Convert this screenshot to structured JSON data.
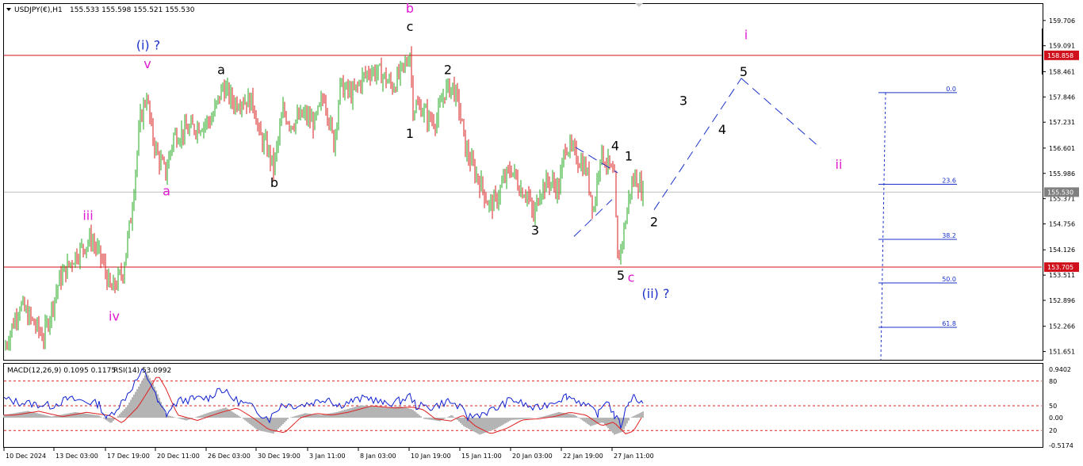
{
  "header": {
    "symbol": "USDJPY(€),H1",
    "quote": "155.533 155.598 155.521 155.530"
  },
  "indicator_header": {
    "macd": "MACD(12,26,9) 0.1095 0.1175",
    "rsi": "RSI(14) 53.0992"
  },
  "colors": {
    "bull": "#22a822",
    "bear": "#d81e1e",
    "hline": "#d0101a",
    "magenta": "#e01ad0",
    "blue": "#1a32c8",
    "black": "#000000",
    "macd_hist": "#b4b4b4",
    "macd_signal": "#e02020",
    "rsi_line": "#1020d0"
  },
  "chart_data": [
    {
      "type": "candlestick",
      "symbol": "USDJPY(€)",
      "timeframe": "H1",
      "ohlc_last": {
        "open": 155.533,
        "high": 155.598,
        "low": 155.521,
        "close": 155.53
      },
      "ylim": [
        151.45,
        160.05
      ],
      "y_tick_labels": [
        "159.706",
        "159.091",
        "158.461",
        "157.846",
        "157.231",
        "156.601",
        "155.986",
        "155.371",
        "154.756",
        "154.126",
        "153.511",
        "152.896",
        "152.266",
        "151.651"
      ],
      "x_tick_labels": [
        "10 Dec 2024",
        "13 Dec 03:00",
        "17 Dec 19:00",
        "20 Dec 11:00",
        "26 Dec 03:00",
        "30 Dec 19:00",
        "3 Jan 11:00",
        "8 Jan 03:00",
        "10 Jan 19:00",
        "15 Jan 11:00",
        "20 Jan 03:00",
        "22 Jan 19:00",
        "27 Jan 11:00"
      ],
      "price_path": [
        [
          0,
          151.7
        ],
        [
          20,
          152.8
        ],
        [
          50,
          152.0
        ],
        [
          70,
          153.4
        ],
        [
          90,
          154.0
        ],
        [
          110,
          154.4
        ],
        [
          125,
          153.8
        ],
        [
          135,
          153.1
        ],
        [
          150,
          153.6
        ],
        [
          160,
          154.9
        ],
        [
          168,
          156.5
        ],
        [
          172,
          157.3
        ],
        [
          180,
          157.9
        ],
        [
          186,
          157.0
        ],
        [
          194,
          156.4
        ],
        [
          204,
          156.0
        ],
        [
          214,
          156.9
        ],
        [
          226,
          157.0
        ],
        [
          240,
          157.1
        ],
        [
          262,
          157.3
        ],
        [
          276,
          158.1
        ],
        [
          290,
          157.7
        ],
        [
          300,
          157.8
        ],
        [
          315,
          157.7
        ],
        [
          322,
          156.9
        ],
        [
          332,
          156.6
        ],
        [
          340,
          156.1
        ],
        [
          352,
          157.5
        ],
        [
          362,
          157.2
        ],
        [
          378,
          157.4
        ],
        [
          392,
          157.2
        ],
        [
          404,
          157.9
        ],
        [
          416,
          156.7
        ],
        [
          424,
          158.1
        ],
        [
          440,
          157.9
        ],
        [
          452,
          158.3
        ],
        [
          462,
          158.5
        ],
        [
          476,
          158.4
        ],
        [
          490,
          158.1
        ],
        [
          500,
          158.4
        ],
        [
          508,
          158.7
        ],
        [
          512,
          158.95
        ],
        [
          516,
          157.6
        ],
        [
          526,
          157.6
        ],
        [
          536,
          157.3
        ],
        [
          546,
          157.3
        ],
        [
          556,
          158.0
        ],
        [
          566,
          158.1
        ],
        [
          574,
          157.6
        ],
        [
          582,
          156.6
        ],
        [
          592,
          156.1
        ],
        [
          602,
          155.7
        ],
        [
          612,
          155.2
        ],
        [
          620,
          155.3
        ],
        [
          630,
          155.8
        ],
        [
          640,
          156.1
        ],
        [
          652,
          155.6
        ],
        [
          660,
          155.5
        ],
        [
          668,
          154.9
        ],
        [
          676,
          155.6
        ],
        [
          688,
          155.8
        ],
        [
          700,
          155.6
        ],
        [
          708,
          156.7
        ],
        [
          722,
          156.4
        ],
        [
          734,
          156.1
        ],
        [
          744,
          155.1
        ],
        [
          752,
          156.5
        ],
        [
          762,
          156.2
        ],
        [
          770,
          155.8
        ],
        [
          774,
          153.8
        ],
        [
          782,
          154.6
        ],
        [
          790,
          155.6
        ],
        [
          796,
          155.9
        ],
        [
          806,
          155.53
        ]
      ],
      "horizontal_levels": [
        158.858,
        153.705
      ],
      "current_price": 155.53,
      "fibonacci": {
        "levels": [
          "0.0",
          "23.6",
          "38.2",
          "50.0",
          "61.8"
        ],
        "prices": [
          157.95,
          155.72,
          154.38,
          153.32,
          152.24
        ]
      },
      "projection": {
        "points": [
          [
            820,
            155.1
          ],
          [
            930,
            158.3
          ],
          [
            1030,
            156.6
          ]
        ]
      },
      "wave_labels": [
        {
          "text": "(i) ?",
          "price": 159.0,
          "bar": 182,
          "color": "blue"
        },
        {
          "text": "v",
          "price": 158.55,
          "bar": 181,
          "color": "magenta"
        },
        {
          "text": "a",
          "price": 158.4,
          "bar": 274,
          "color": "black"
        },
        {
          "text": "a",
          "price": 155.45,
          "bar": 205,
          "color": "magenta"
        },
        {
          "text": "b",
          "price": 155.65,
          "bar": 341,
          "color": "black"
        },
        {
          "text": "b",
          "price": 159.9,
          "bar": 512,
          "color": "magenta"
        },
        {
          "text": "c",
          "price": 159.45,
          "bar": 512,
          "color": "black"
        },
        {
          "text": "2",
          "price": 158.4,
          "bar": 560,
          "color": "black"
        },
        {
          "text": "1",
          "price": 156.85,
          "bar": 512,
          "color": "black"
        },
        {
          "text": "3",
          "price": 154.5,
          "bar": 670,
          "color": "black"
        },
        {
          "text": "4",
          "price": 156.55,
          "bar": 771,
          "color": "black"
        },
        {
          "text": "1",
          "price": 156.3,
          "bar": 788,
          "color": "black"
        },
        {
          "text": "2",
          "price": 154.7,
          "bar": 820,
          "color": "black"
        },
        {
          "text": "5",
          "price": 153.4,
          "bar": 778,
          "color": "black"
        },
        {
          "text": "c",
          "price": 153.35,
          "bar": 791,
          "color": "magenta"
        },
        {
          "text": "(ii) ?",
          "price": 152.95,
          "bar": 822,
          "color": "blue"
        },
        {
          "text": "iii",
          "price": 154.85,
          "bar": 106,
          "color": "magenta"
        },
        {
          "text": "iv",
          "price": 152.4,
          "bar": 139,
          "color": "magenta"
        },
        {
          "text": "i",
          "price": 159.25,
          "bar": 936,
          "color": "magenta"
        },
        {
          "text": "5",
          "price": 158.35,
          "bar": 933,
          "color": "black"
        },
        {
          "text": "3",
          "price": 157.65,
          "bar": 857,
          "color": "black"
        },
        {
          "text": "4",
          "price": 156.95,
          "bar": 906,
          "color": "black"
        },
        {
          "text": "ii",
          "price": 156.1,
          "bar": 1053,
          "color": "magenta"
        }
      ]
    },
    {
      "type": "line",
      "name": "MACD(12,26,9) / RSI(14)",
      "macd_main": 0.1095,
      "macd_signal": 0.1175,
      "rsi": 53.0992,
      "y_tick_labels": [
        "0.9402",
        "80",
        "50",
        "0.00",
        "20",
        "-0.5174"
      ],
      "rsi_levels": [
        80,
        50,
        20
      ],
      "rsi_path": [
        [
          0,
          58
        ],
        [
          20,
          54
        ],
        [
          40,
          52
        ],
        [
          60,
          50
        ],
        [
          80,
          58
        ],
        [
          100,
          56
        ],
        [
          120,
          52
        ],
        [
          130,
          34
        ],
        [
          150,
          56
        ],
        [
          165,
          78
        ],
        [
          175,
          92
        ],
        [
          185,
          78
        ],
        [
          195,
          52
        ],
        [
          205,
          40
        ],
        [
          220,
          56
        ],
        [
          240,
          58
        ],
        [
          260,
          60
        ],
        [
          272,
          72
        ],
        [
          290,
          58
        ],
        [
          310,
          50
        ],
        [
          325,
          40
        ],
        [
          335,
          34
        ],
        [
          350,
          52
        ],
        [
          370,
          50
        ],
        [
          390,
          54
        ],
        [
          410,
          60
        ],
        [
          420,
          50
        ],
        [
          440,
          56
        ],
        [
          460,
          60
        ],
        [
          480,
          52
        ],
        [
          500,
          56
        ],
        [
          512,
          62
        ],
        [
          520,
          50
        ],
        [
          540,
          48
        ],
        [
          560,
          56
        ],
        [
          575,
          48
        ],
        [
          585,
          36
        ],
        [
          600,
          40
        ],
        [
          620,
          46
        ],
        [
          640,
          58
        ],
        [
          655,
          52
        ],
        [
          670,
          46
        ],
        [
          685,
          52
        ],
        [
          700,
          58
        ],
        [
          710,
          62
        ],
        [
          725,
          56
        ],
        [
          740,
          46
        ],
        [
          750,
          40
        ],
        [
          760,
          58
        ],
        [
          770,
          38
        ],
        [
          778,
          26
        ],
        [
          788,
          56
        ],
        [
          795,
          62
        ],
        [
          806,
          53
        ]
      ],
      "macd_path": [
        [
          0,
          0.05
        ],
        [
          30,
          0.12
        ],
        [
          60,
          0.02
        ],
        [
          90,
          0.1
        ],
        [
          120,
          0.04
        ],
        [
          135,
          -0.1
        ],
        [
          155,
          0.2
        ],
        [
          170,
          0.55
        ],
        [
          180,
          0.8
        ],
        [
          190,
          0.55
        ],
        [
          205,
          0.05
        ],
        [
          230,
          -0.05
        ],
        [
          260,
          0.1
        ],
        [
          280,
          0.18
        ],
        [
          300,
          0.0
        ],
        [
          320,
          -0.22
        ],
        [
          340,
          -0.28
        ],
        [
          360,
          0.0
        ],
        [
          380,
          0.08
        ],
        [
          400,
          0.05
        ],
        [
          420,
          0.1
        ],
        [
          450,
          0.22
        ],
        [
          480,
          0.18
        ],
        [
          500,
          0.2
        ],
        [
          515,
          0.15
        ],
        [
          530,
          -0.02
        ],
        [
          550,
          -0.06
        ],
        [
          565,
          0.05
        ],
        [
          580,
          -0.15
        ],
        [
          600,
          -0.3
        ],
        [
          620,
          -0.2
        ],
        [
          640,
          -0.04
        ],
        [
          660,
          -0.02
        ],
        [
          680,
          0.02
        ],
        [
          700,
          0.1
        ],
        [
          720,
          0.05
        ],
        [
          740,
          -0.15
        ],
        [
          755,
          -0.08
        ],
        [
          770,
          -0.3
        ],
        [
          780,
          -0.25
        ],
        [
          790,
          0.0
        ],
        [
          806,
          0.11
        ]
      ]
    }
  ]
}
